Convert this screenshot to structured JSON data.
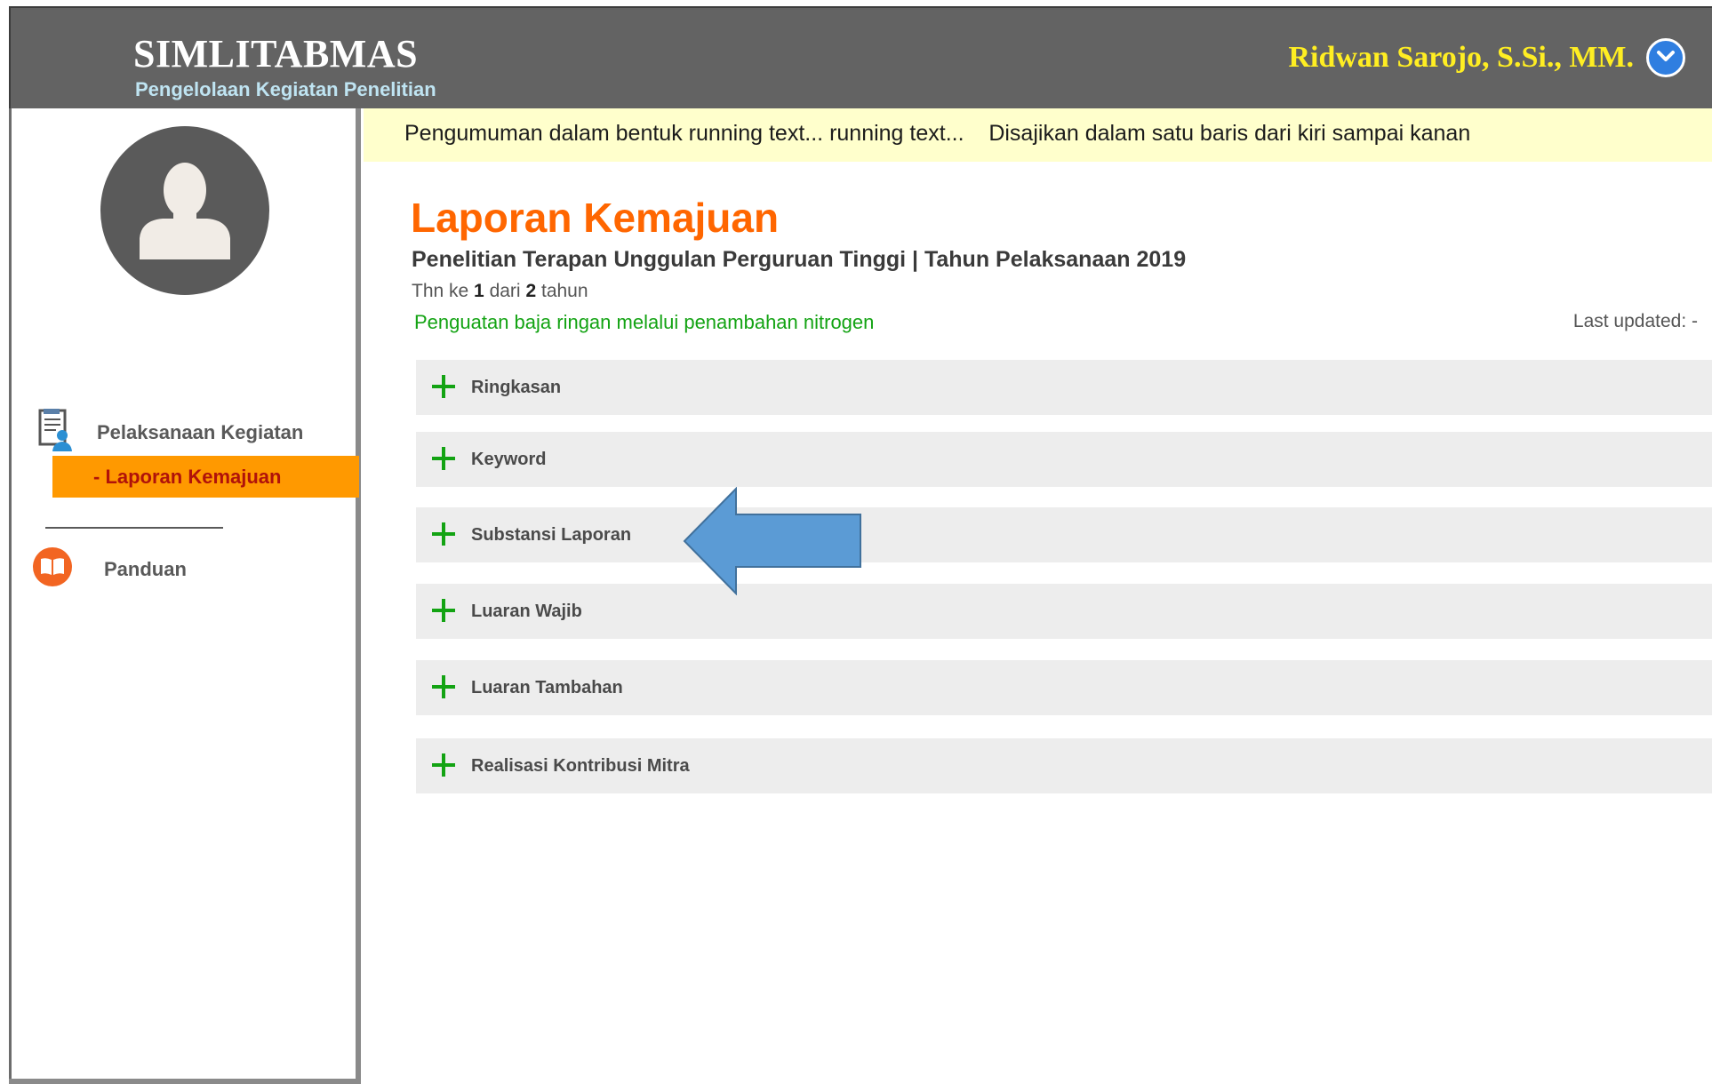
{
  "header": {
    "brand_title": "SIMLITABMAS",
    "brand_subtitle": "Pengelolaan Kegiatan Penelitian",
    "user_name": "Ridwan Sarojo, S.Si., MM.",
    "dropdown_icon": "chevron-down-circle-icon"
  },
  "sidebar": {
    "avatar_icon": "user-avatar-icon",
    "group": {
      "icon": "document-person-icon",
      "label": "Pelaksanaan Kegiatan"
    },
    "active_item": {
      "label": "- Laporan Kemajuan"
    },
    "guide": {
      "icon": "book-icon",
      "label": "Panduan"
    }
  },
  "announcement": {
    "text": "Pengumuman dalam bentuk running text... running text...    Disajikan dalam satu baris dari kiri sampai kanan"
  },
  "main": {
    "title": "Laporan Kemajuan",
    "subtitle": "Penelitian Terapan Unggulan Perguruan Tinggi | Tahun Pelaksanaan 2019",
    "year_prefix": "Thn ke",
    "year_current": "1",
    "year_mid": "dari",
    "year_total": "2",
    "year_suffix": "tahun",
    "research_title": "Penguatan baja ringan melalui penambahan nitrogen",
    "last_updated": "Last updated: -",
    "sections": [
      {
        "label": "Ringkasan"
      },
      {
        "label": "Keyword"
      },
      {
        "label": "Substansi Laporan"
      },
      {
        "label": "Luaran Wajib"
      },
      {
        "label": "Luaran Tambahan"
      },
      {
        "label": "Realisasi Kontribusi Mitra"
      }
    ],
    "expand_icon": "plus-icon",
    "pointer_icon": "left-arrow-icon"
  },
  "colors": {
    "header_bg": "#636363",
    "brand_sub": "#bfe4f2",
    "user_name": "#ffee22",
    "title_orange": "#ff6600",
    "active_nav": "#ff9900",
    "active_nav_text": "#b0120a",
    "research_green": "#13a313",
    "announce_bg": "#ffffcc",
    "section_bg": "#ededed",
    "arrow_blue": "#5b9bd5"
  }
}
